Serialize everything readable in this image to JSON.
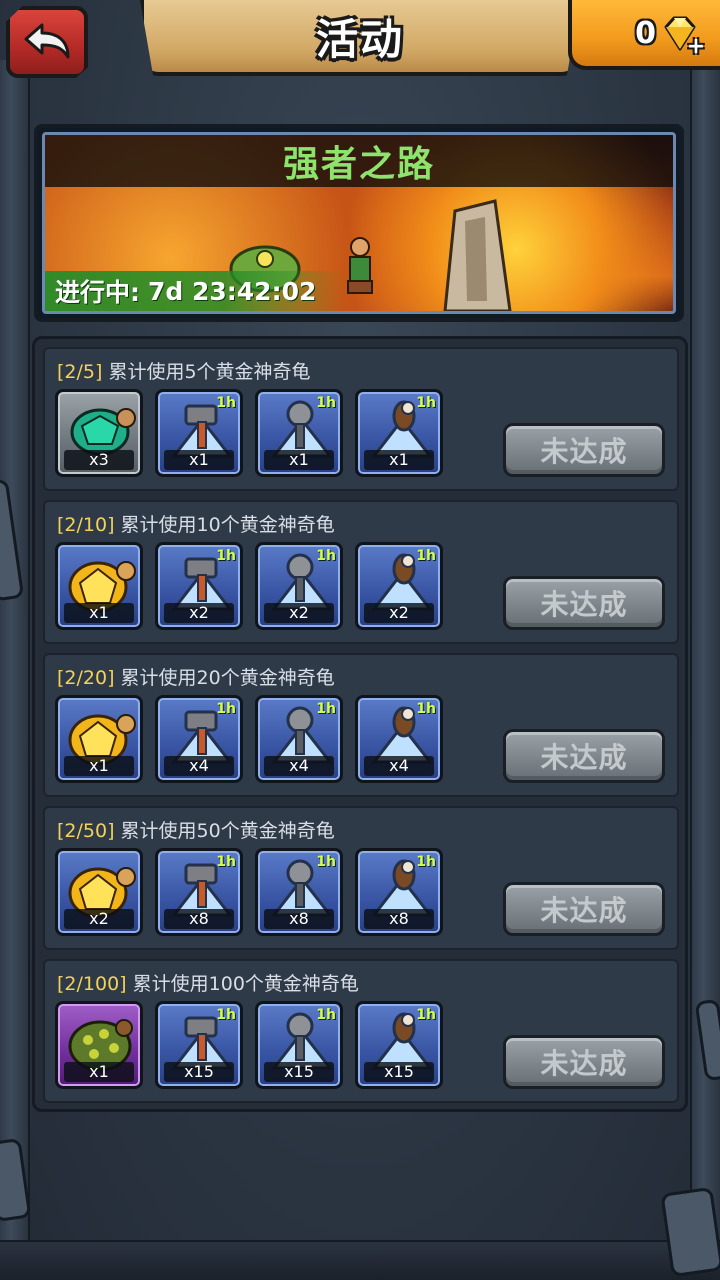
{
  "header": {
    "title": "活动",
    "gem_count": "0"
  },
  "banner": {
    "title": "强者之路",
    "status_label": "进行中:",
    "timer": "7d 23:42:02"
  },
  "tasks": [
    {
      "progress": "[2/5]",
      "desc": "累计使用5个黄金神奇龟",
      "rewards": [
        {
          "icon": "green-turtle-icon",
          "qty": "x3",
          "duration": ""
        },
        {
          "icon": "hammer-speedup-icon",
          "qty": "x1",
          "duration": "1h"
        },
        {
          "icon": "mallet-speedup-icon",
          "qty": "x1",
          "duration": "1h"
        },
        {
          "icon": "club-speedup-icon",
          "qty": "x1",
          "duration": "1h"
        }
      ],
      "button": "未达成"
    },
    {
      "progress": "[2/10]",
      "desc": "累计使用10个黄金神奇龟",
      "rewards": [
        {
          "icon": "golden-turtle-icon",
          "qty": "x1",
          "duration": ""
        },
        {
          "icon": "hammer-speedup-icon",
          "qty": "x2",
          "duration": "1h"
        },
        {
          "icon": "mallet-speedup-icon",
          "qty": "x2",
          "duration": "1h"
        },
        {
          "icon": "club-speedup-icon",
          "qty": "x2",
          "duration": "1h"
        }
      ],
      "button": "未达成"
    },
    {
      "progress": "[2/20]",
      "desc": "累计使用20个黄金神奇龟",
      "rewards": [
        {
          "icon": "golden-turtle-icon",
          "qty": "x1",
          "duration": ""
        },
        {
          "icon": "hammer-speedup-icon",
          "qty": "x4",
          "duration": "1h"
        },
        {
          "icon": "mallet-speedup-icon",
          "qty": "x4",
          "duration": "1h"
        },
        {
          "icon": "club-speedup-icon",
          "qty": "x4",
          "duration": "1h"
        }
      ],
      "button": "未达成"
    },
    {
      "progress": "[2/50]",
      "desc": "累计使用50个黄金神奇龟",
      "rewards": [
        {
          "icon": "golden-turtle-icon",
          "qty": "x2",
          "duration": ""
        },
        {
          "icon": "hammer-speedup-icon",
          "qty": "x8",
          "duration": "1h"
        },
        {
          "icon": "mallet-speedup-icon",
          "qty": "x8",
          "duration": "1h"
        },
        {
          "icon": "club-speedup-icon",
          "qty": "x8",
          "duration": "1h"
        }
      ],
      "button": "未达成"
    },
    {
      "progress": "[2/100]",
      "desc": "累计使用100个黄金神奇龟",
      "rewards": [
        {
          "icon": "spiked-turtle-icon",
          "qty": "x1",
          "duration": ""
        },
        {
          "icon": "hammer-speedup-icon",
          "qty": "x15",
          "duration": "1h"
        },
        {
          "icon": "mallet-speedup-icon",
          "qty": "x15",
          "duration": "1h"
        },
        {
          "icon": "club-speedup-icon",
          "qty": "x15",
          "duration": "1h"
        }
      ],
      "button": "未达成"
    }
  ]
}
